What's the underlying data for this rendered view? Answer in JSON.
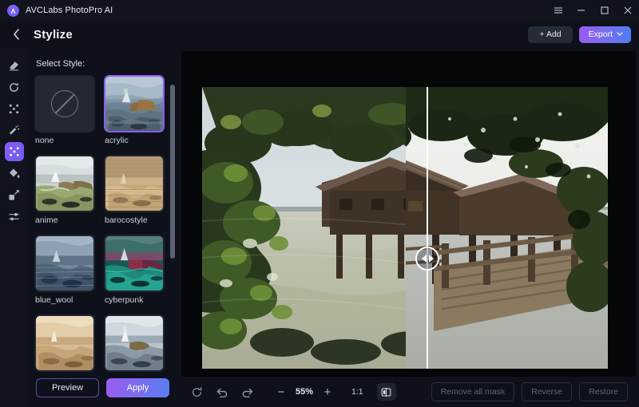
{
  "window": {
    "app_title": "AVCLabs PhotoPro AI",
    "logo_text": "A",
    "controls": [
      {
        "name": "menu",
        "icon": "hamburger-icon"
      },
      {
        "name": "minimize",
        "icon": "minimize-icon"
      },
      {
        "name": "maximize",
        "icon": "maximize-icon"
      },
      {
        "name": "close",
        "icon": "close-icon"
      }
    ]
  },
  "header": {
    "back_icon": "chevron-left-icon",
    "title": "Stylize",
    "add_label": "+ Add",
    "export_label": "Export",
    "export_chevron": "⌄"
  },
  "rail": {
    "items": [
      {
        "icon": "eraser-icon",
        "active": false
      },
      {
        "icon": "refresh-icon",
        "active": false
      },
      {
        "icon": "enhance-dots-icon",
        "active": false
      },
      {
        "icon": "magic-wand-icon",
        "active": false
      },
      {
        "icon": "stylize-icon",
        "active": true
      },
      {
        "icon": "paint-bucket-icon",
        "active": false
      },
      {
        "icon": "resize-icon",
        "active": false
      },
      {
        "icon": "adjust-sliders-icon",
        "active": false
      }
    ]
  },
  "panel": {
    "label": "Select Style:",
    "styles": [
      {
        "name": "none",
        "selected": false,
        "kind": "none"
      },
      {
        "name": "acrylic",
        "selected": true,
        "kind": "acrylic"
      },
      {
        "name": "anime",
        "selected": false,
        "kind": "anime"
      },
      {
        "name": "barocostyle",
        "selected": false,
        "kind": "barocostyle"
      },
      {
        "name": "blue_wool",
        "selected": false,
        "kind": "blue_wool"
      },
      {
        "name": "cyberpunk",
        "selected": false,
        "kind": "cyberpunk"
      },
      {
        "name": "",
        "selected": false,
        "kind": "sepia"
      },
      {
        "name": "",
        "selected": false,
        "kind": "sketch"
      }
    ],
    "preview_label": "Preview",
    "apply_label": "Apply"
  },
  "canvas": {
    "split_position_percent": 50,
    "handle_left_icon": "triangle-left-icon",
    "handle_right_icon": "triangle-right-icon",
    "image_description": "Lakeside wooden boathouse with pier, left half stylized as acrylic painting, right half original photo"
  },
  "toolbar": {
    "reset_icon": "reset-icon",
    "undo_icon": "undo-icon",
    "redo_icon": "redo-icon",
    "zoom_out_label": "−",
    "zoom_value": "55%",
    "zoom_in_label": "+",
    "ratio_label": "1:1",
    "split_view_icon": "split-view-icon",
    "remove_all_mask_label": "Remove all mask",
    "reverse_label": "Reverse",
    "restore_label": "Restore"
  },
  "colors": {
    "accent_purple": "#8b5cf6",
    "accent_blue": "#4f7ef5",
    "panel_bg": "#0e1119",
    "rail_bg": "#11141d",
    "canvas_bg": "#040608"
  }
}
